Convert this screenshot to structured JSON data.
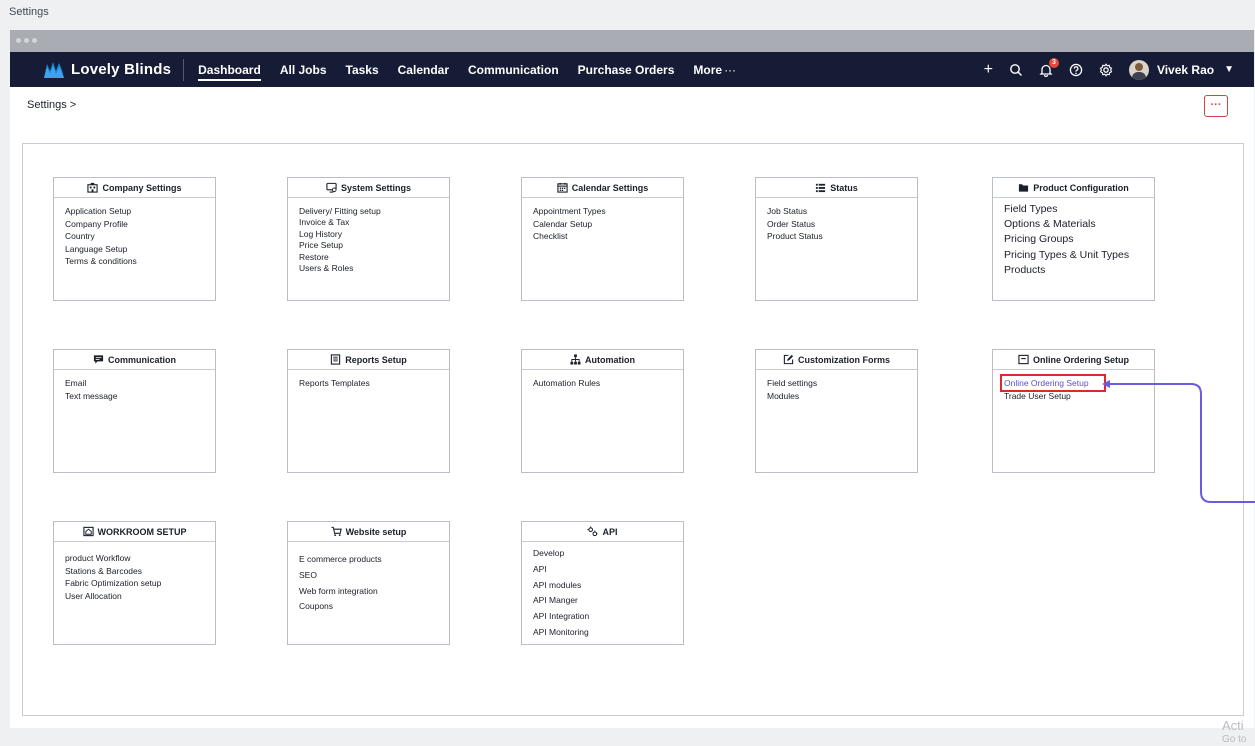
{
  "page_label": "Settings",
  "app": {
    "brand": "Lovely Blinds",
    "brand_color": "#1a86d8"
  },
  "nav": {
    "items": [
      {
        "label": "Dashboard",
        "active": true
      },
      {
        "label": "All Jobs"
      },
      {
        "label": "Tasks"
      },
      {
        "label": "Calendar"
      },
      {
        "label": "Communication"
      },
      {
        "label": "Purchase Orders"
      },
      {
        "label": "More"
      }
    ],
    "more_suffix": "···",
    "add_icon": "+",
    "notification_count": "3",
    "user_name": "Vivek Rao",
    "user_caret": "▼"
  },
  "breadcrumb": "Settings >",
  "kebab_label": "···",
  "cards": {
    "company": {
      "title": "Company Settings",
      "icon": "building-icon",
      "links": [
        "Application Setup",
        "Company Profile",
        "Country",
        "Language Setup",
        "Terms & conditions"
      ]
    },
    "system": {
      "title": "System Settings",
      "icon": "monitor-settings-icon",
      "links": [
        "Delivery/ Fitting setup",
        "Invoice & Tax",
        "Log History",
        "Price Setup",
        "Restore",
        "Users & Roles"
      ]
    },
    "calendar": {
      "title": "Calendar Settings",
      "icon": "calendar-icon",
      "links": [
        "Appointment Types",
        "Calendar Setup",
        "Checklist"
      ]
    },
    "status": {
      "title": "Status",
      "icon": "status-grid-icon",
      "links": [
        "Job Status",
        "Order Status",
        "Product Status"
      ]
    },
    "product": {
      "title": "Product Configuration",
      "icon": "folder-icon",
      "links": [
        "Field Types",
        "Options & Materials",
        "Pricing Groups",
        "Pricing Types & Unit Types",
        "Products"
      ]
    },
    "communication": {
      "title": "Communication",
      "icon": "chat-icon",
      "links": [
        "Email",
        "Text message"
      ]
    },
    "reports": {
      "title": "Reports Setup",
      "icon": "report-icon",
      "links": [
        "Reports Templates"
      ]
    },
    "automation": {
      "title": "Automation",
      "icon": "hierarchy-icon",
      "links": [
        "Automation Rules"
      ]
    },
    "customization": {
      "title": "Customization Forms",
      "icon": "edit-form-icon",
      "links": [
        "Field settings",
        "Modules"
      ]
    },
    "online": {
      "title": "Online Ordering Setup",
      "icon": "window-icon",
      "links": [
        "Online Ordering Setup",
        "Trade User Setup"
      ],
      "highlight_color": "#5a4fd8"
    },
    "workroom": {
      "title": "WORKROOM SETUP",
      "icon": "workroom-icon",
      "links": [
        "product Workflow",
        "Stations & Barcodes",
        "Fabric Optimization setup",
        "User Allocation"
      ]
    },
    "website": {
      "title": "Website setup",
      "icon": "cart-icon",
      "links": [
        "E commerce products",
        "SEO",
        "Web form integration",
        "Coupons"
      ]
    },
    "api": {
      "title": "API",
      "icon": "api-icon",
      "links": [
        "Develop",
        "API",
        "API modules",
        "API Manger",
        "API Integration",
        "API Monitoring"
      ]
    }
  },
  "watermark": {
    "line1": "Acti",
    "line2": "Go to"
  }
}
